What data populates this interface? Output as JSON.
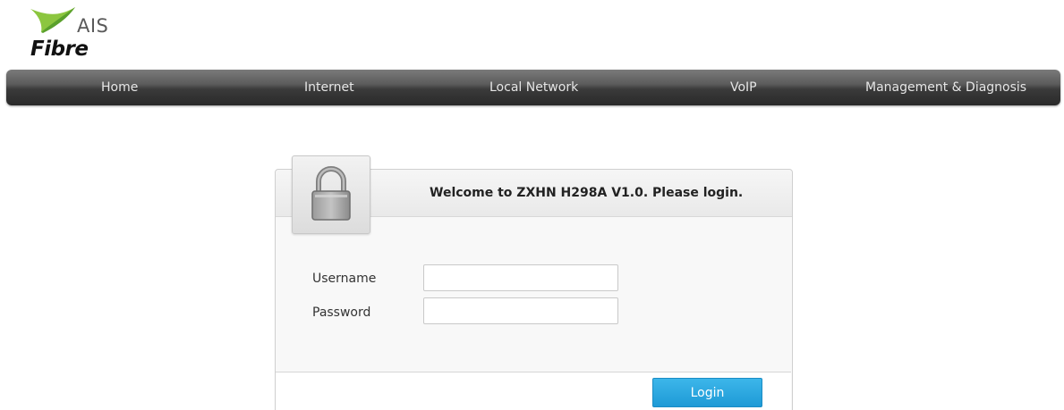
{
  "logo": {
    "brand": "AIS",
    "product": "Fibre"
  },
  "nav": {
    "items": [
      {
        "label": "Home"
      },
      {
        "label": "Internet"
      },
      {
        "label": "Local Network"
      },
      {
        "label": "VoIP"
      },
      {
        "label": "Management & Diagnosis"
      }
    ]
  },
  "login": {
    "title": "Welcome to ZXHN H298A V1.0. Please login.",
    "username_label": "Username",
    "username_value": "",
    "password_label": "Password",
    "password_value": "",
    "button_label": "Login",
    "icon": "lock-icon"
  },
  "colors": {
    "accent": "#2aa6e0",
    "navbar": "#3a3a3a",
    "logo_green": "#8cc63f"
  }
}
